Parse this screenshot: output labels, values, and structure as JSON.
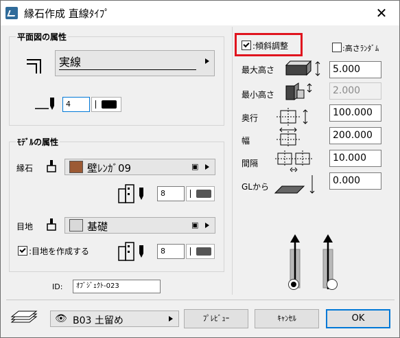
{
  "window": {
    "title": "縁石作成 直線ﾀｲﾌﾟ",
    "close": "✕"
  },
  "plan": {
    "group_label": "平面図の属性",
    "line_type": "実線",
    "pen_value": "4"
  },
  "model": {
    "group_label": "ﾓﾃﾞﾙの属性",
    "curb_label": "縁石",
    "curb_material": "壁ﾚﾝｶﾞ09",
    "curb_pen": "8",
    "joint_label": "目地",
    "joint_material": "基礎",
    "create_joint_label": ":目地を作成する",
    "joint_pen": "8"
  },
  "id": {
    "label": "ID:",
    "value": "ｵﾌﾞｼﾞｪｸﾄ-023"
  },
  "params": {
    "slope_label": ":傾斜調整",
    "random_label": ":高さﾗﾝﾀﾞﾑ",
    "max_height_label": "最大高さ",
    "max_height": "5.000",
    "min_height_label": "最小高さ",
    "min_height": "2.000",
    "depth_label": "奥行",
    "depth": "100.000",
    "width_label": "幅",
    "width": "200.000",
    "gap_label": "間隔",
    "gap": "10.000",
    "gl_label": "GLから",
    "gl": "0.000"
  },
  "footer": {
    "layer": "B03 土留め",
    "preview": "ﾌﾟﾚﾋﾞｭｰ",
    "cancel": "ｷｬﾝｾﾙ",
    "ok": "OK"
  },
  "colors": {
    "curb_swatch": "#9c5a34",
    "joint_swatch": "#d9d9d9",
    "highlight": "#e0141e",
    "ok_border": "#0078d7"
  }
}
